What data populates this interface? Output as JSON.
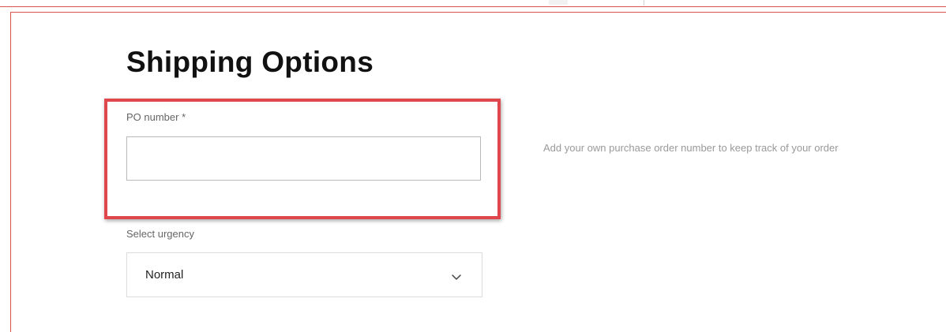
{
  "page": {
    "title": "Shipping Options"
  },
  "po_number": {
    "label": "PO number *",
    "value": "",
    "placeholder": "",
    "hint": "Add your own purchase order number to keep track of your order"
  },
  "urgency": {
    "label": "Select urgency",
    "selected": "Normal"
  },
  "icons": {
    "dropdown": "chevron-down-icon"
  },
  "colors": {
    "highlight": "#e0474c",
    "frame": "#d9534f",
    "title": "#111111",
    "hint": "#9a9a9a"
  }
}
